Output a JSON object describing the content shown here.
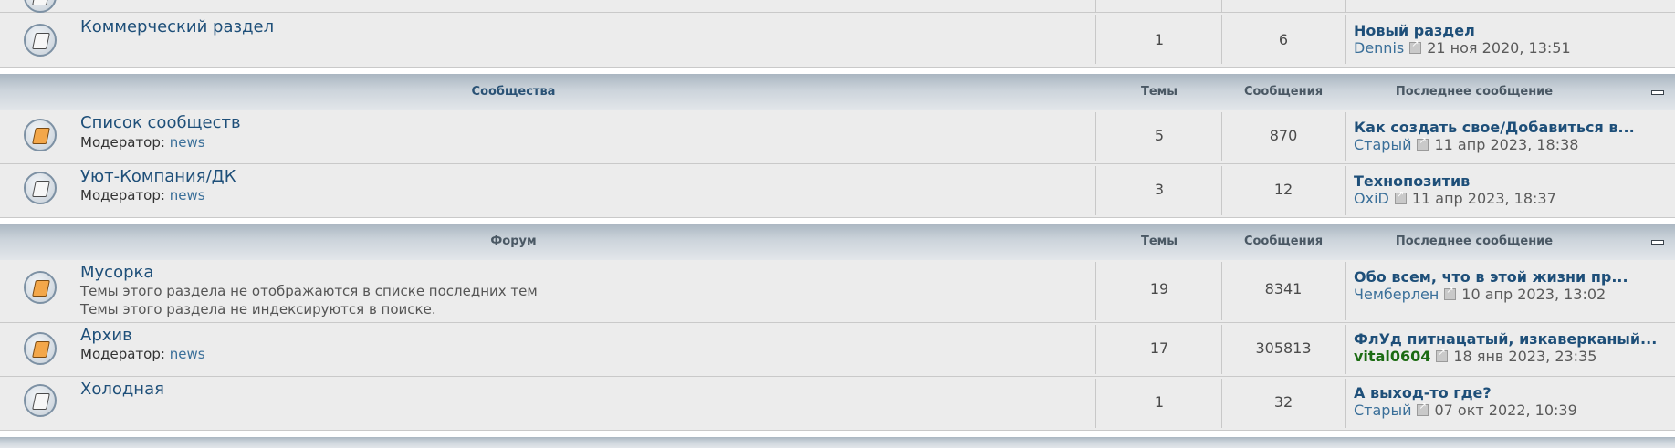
{
  "headers": {
    "communities": {
      "title": "Сообщества",
      "topics": "Темы",
      "posts": "Сообщения",
      "last": "Последнее сообщение"
    },
    "forum": {
      "title": "Форум",
      "topics": "Темы",
      "posts": "Сообщения",
      "last": "Последнее сообщение"
    }
  },
  "rows": {
    "commercial": {
      "title": "Коммерческий раздел",
      "topics": "1",
      "posts": "6",
      "last_title": "Новый раздел",
      "last_user": "Dennis",
      "last_date": "21 ноя 2020, 13:51"
    },
    "communities_list": {
      "title": "Список сообществ",
      "mod_label": "Модератор:",
      "mod": "news",
      "topics": "5",
      "posts": "870",
      "last_title": "Как создать свое/Добавиться в...",
      "last_user": "Старый",
      "last_date": "11 апр 2023, 18:38"
    },
    "uyut": {
      "title": "Уют-Компания/ДК",
      "mod_label": "Модератор:",
      "mod": "news",
      "topics": "3",
      "posts": "12",
      "last_title": "Технопозитив",
      "last_user": "OxiD",
      "last_date": "11 апр 2023, 18:37"
    },
    "musorka": {
      "title": "Мусорка",
      "desc1": "Темы этого раздела не отображаются в списке последних тем",
      "desc2": "Темы этого раздела не индексируются в поиске.",
      "topics": "19",
      "posts": "8341",
      "last_title": "Обо всем, что в этой жизни пр...",
      "last_user": "Чемберлен",
      "last_date": "10 апр 2023, 13:02"
    },
    "archive": {
      "title": "Архив",
      "mod_label": "Модератор:",
      "mod": "news",
      "topics": "17",
      "posts": "305813",
      "last_title": "ФлУд питнацатый, изкаверканый...",
      "last_user": "vital0604",
      "last_date": "18 янв 2023, 23:35"
    },
    "cold": {
      "title": "Холодная",
      "topics": "1",
      "posts": "32",
      "last_title": "А выход-то где?",
      "last_user": "Старый",
      "last_date": "07 окт 2022, 10:39"
    }
  }
}
